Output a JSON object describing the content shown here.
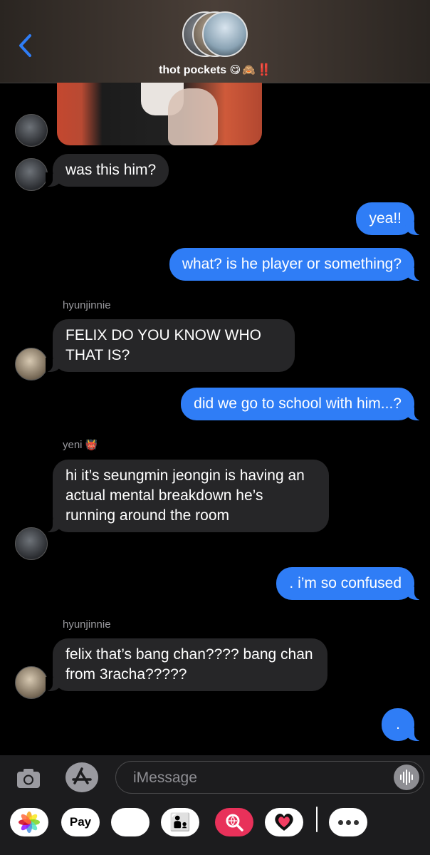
{
  "header": {
    "title": "thot pockets",
    "title_emoji": "😋🙈",
    "title_excl": "‼️"
  },
  "messages": [
    {
      "type": "in",
      "text": "was this him?"
    },
    {
      "type": "out",
      "text": "yea!!"
    },
    {
      "type": "out",
      "text": "what? is he player or something?"
    },
    {
      "type": "sender",
      "text": "hyunjinnie"
    },
    {
      "type": "in",
      "text": "FELIX DO YOU KNOW WHO THAT IS?"
    },
    {
      "type": "out",
      "text": "did we go to school with him...?"
    },
    {
      "type": "sender",
      "text": "yeni",
      "emoji": "👹"
    },
    {
      "type": "in",
      "text": "hi it’s seungmin jeongin is having an actual mental breakdown he’s running around the room"
    },
    {
      "type": "out",
      "text": ". i’m so confused"
    },
    {
      "type": "sender",
      "text": "hyunjinnie"
    },
    {
      "type": "in",
      "text": "felix that’s bang chan???? bang chan from 3racha?????"
    },
    {
      "type": "out",
      "text": "."
    }
  ],
  "composer": {
    "placeholder": "iMessage"
  },
  "drawer": {
    "apple_pay_label": "Pay",
    "apple_pay_glyph": "",
    "monkey_emoji": "🐵",
    "memoji_emoji": "👨‍👦"
  },
  "icons": {
    "back": "chevron-left-icon",
    "camera": "camera-icon",
    "apps": "app-store-icon",
    "voice": "waveform-icon",
    "photos": "photos-icon",
    "search": "image-search-icon",
    "heart": "digital-touch-icon",
    "more": "more-icon"
  },
  "colors": {
    "accent": "#2f7df6",
    "incoming_bubble": "#262628",
    "sender_name": "#9a9a9f",
    "excl": "#ff2b2b"
  }
}
